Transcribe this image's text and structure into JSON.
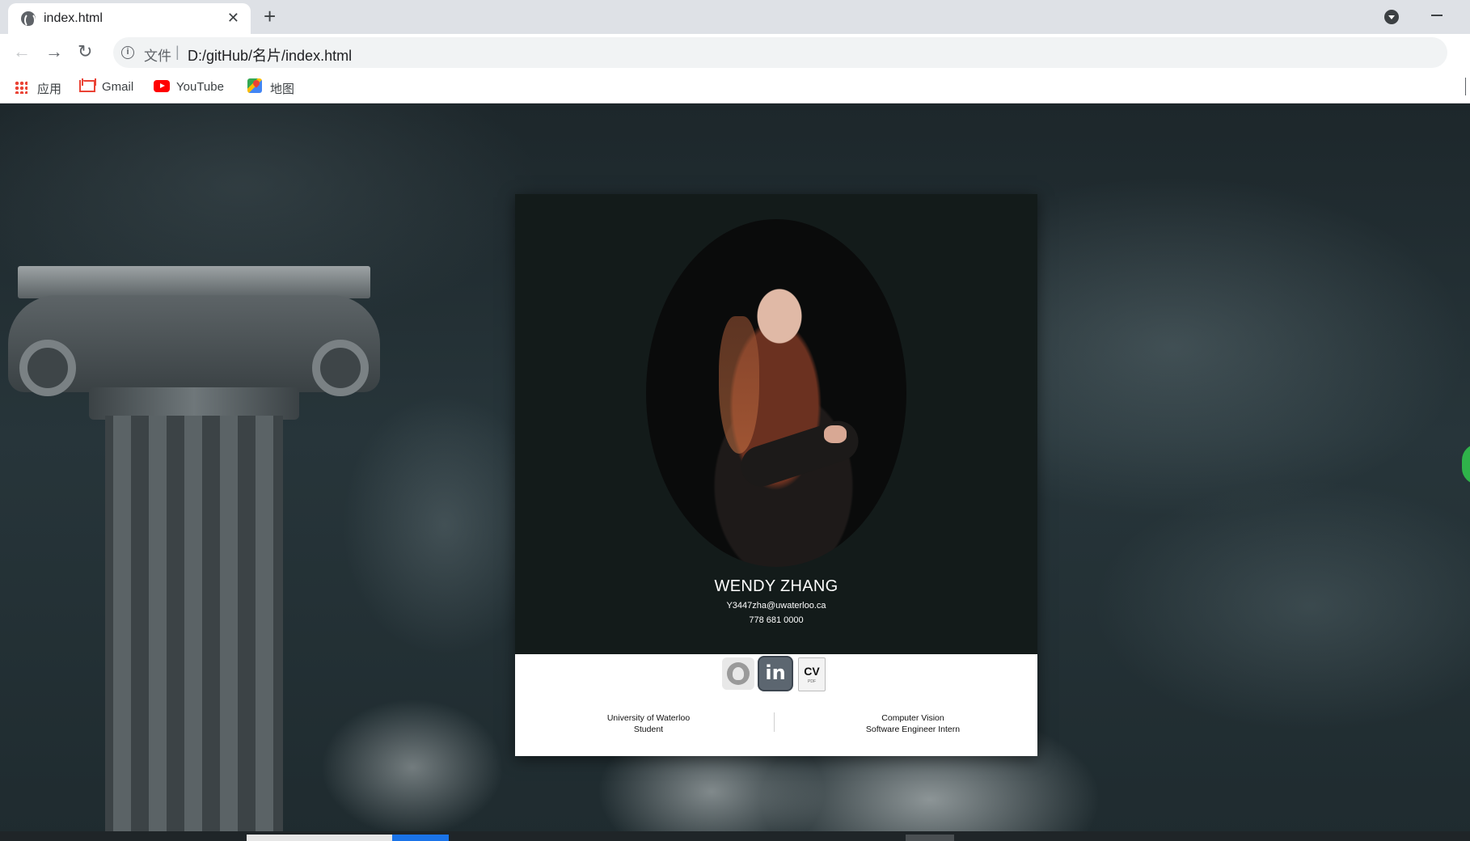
{
  "browser": {
    "tab": {
      "title": "index.html",
      "close_glyph": "✕",
      "icon": "globe-icon"
    },
    "new_tab_glyph": "+",
    "nav": {
      "back_glyph": "←",
      "forward_glyph": "→",
      "reload_glyph": "↻"
    },
    "omnibox": {
      "info_glyph": "i",
      "scheme_label": "文件",
      "separator": "|",
      "url": "D:/gitHub/名片/index.html"
    },
    "zoom_glyph": "🔍",
    "star_glyph": "☆",
    "bookmarks": [
      {
        "label": "应用",
        "icon": "apps-grid-icon"
      },
      {
        "label": "Gmail",
        "icon": "gmail-icon"
      },
      {
        "label": "YouTube",
        "icon": "youtube-icon"
      },
      {
        "label": "地图",
        "icon": "maps-icon"
      }
    ]
  },
  "card": {
    "name": "WENDY ZHANG",
    "email": "Y3447zha@uwaterloo.ca",
    "phone": "778 681 0000",
    "social": {
      "github_icon": "github-icon",
      "linkedin_label": "in",
      "cv_label": "CV",
      "cv_sub": "PDF"
    },
    "left_info": {
      "line1": "University of Waterloo",
      "line2": "Student"
    },
    "right_info": {
      "line1": "Computer Vision",
      "line2": "Software Engineer Intern"
    }
  },
  "colors": {
    "card_dark": "#131b1a",
    "card_light": "#ffffff",
    "linkedin": "#5c6670",
    "accent_blue": "#1a73e8"
  }
}
